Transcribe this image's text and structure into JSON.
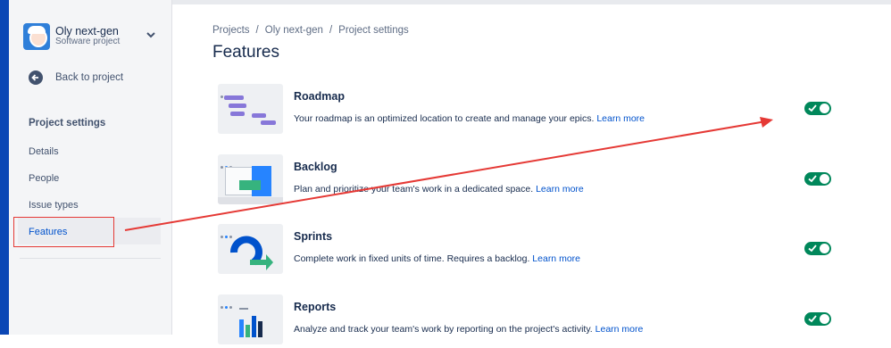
{
  "colors": {
    "primary_link": "#0052cc",
    "toggle_on": "#00875a",
    "annotation_red": "#e53935",
    "sidebar_bg": "#f4f5f7",
    "left_bar": "#0b47b5"
  },
  "sidebar": {
    "project_name": "Oly next-gen",
    "project_type": "Software project",
    "back_label": "Back to project",
    "section_title": "Project settings",
    "items": [
      {
        "label": "Details",
        "active": false
      },
      {
        "label": "People",
        "active": false
      },
      {
        "label": "Issue types",
        "active": false
      },
      {
        "label": "Features",
        "active": true
      }
    ]
  },
  "breadcrumb": [
    "Projects",
    "Oly next-gen",
    "Project settings"
  ],
  "page_title": "Features",
  "features": [
    {
      "name": "Roadmap",
      "description": "Your roadmap is an optimized location to create and manage your epics.",
      "link": "Learn more",
      "enabled": true,
      "icon": "roadmap-illustration-icon"
    },
    {
      "name": "Backlog",
      "description": "Plan and prioritize your team's work in a dedicated space.",
      "link": "Learn more",
      "enabled": true,
      "icon": "backlog-illustration-icon"
    },
    {
      "name": "Sprints",
      "description": "Complete work in fixed units of time. Requires a backlog.",
      "link": "Learn more",
      "enabled": true,
      "icon": "sprints-illustration-icon"
    },
    {
      "name": "Reports",
      "description": "Analyze and track your team's work by reporting on the project's activity.",
      "link": "Learn more",
      "enabled": true,
      "icon": "reports-illustration-icon"
    }
  ]
}
